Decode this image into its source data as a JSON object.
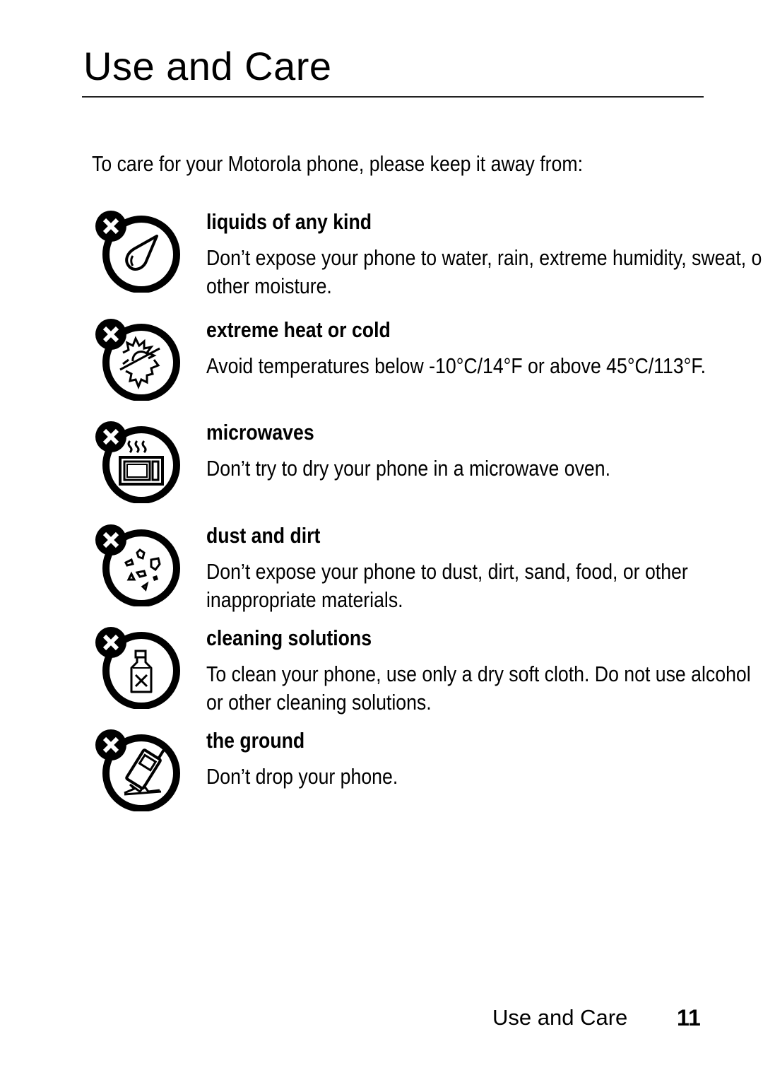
{
  "page": {
    "title": "Use and Care",
    "intro": "To care for your Motorola phone, please keep it away from:",
    "items": [
      {
        "icon": "no-liquids-icon",
        "heading": "liquids of any kind",
        "description": "Don’t expose your phone to water, rain, extreme humidity, sweat, or other moisture."
      },
      {
        "icon": "no-extreme-temperature-icon",
        "heading": "extreme heat or cold",
        "description": "Avoid temperatures below -10°C/14°F or above 45°C/113°F."
      },
      {
        "icon": "no-microwave-icon",
        "heading": "microwaves",
        "description": "Don’t try to dry your phone in a microwave oven."
      },
      {
        "icon": "no-dust-icon",
        "heading": "dust and dirt",
        "description": "Don’t expose your phone to dust, dirt, sand, food, or other inappropriate materials."
      },
      {
        "icon": "no-cleaning-solutions-icon",
        "heading": "cleaning solutions",
        "description": "To clean your phone, use only a dry soft cloth. Do not use alcohol or other cleaning solutions."
      },
      {
        "icon": "no-dropping-icon",
        "heading": "the ground",
        "description": "Don’t drop your phone."
      }
    ],
    "footer": {
      "section": "Use and Care",
      "page_number": "11"
    }
  }
}
